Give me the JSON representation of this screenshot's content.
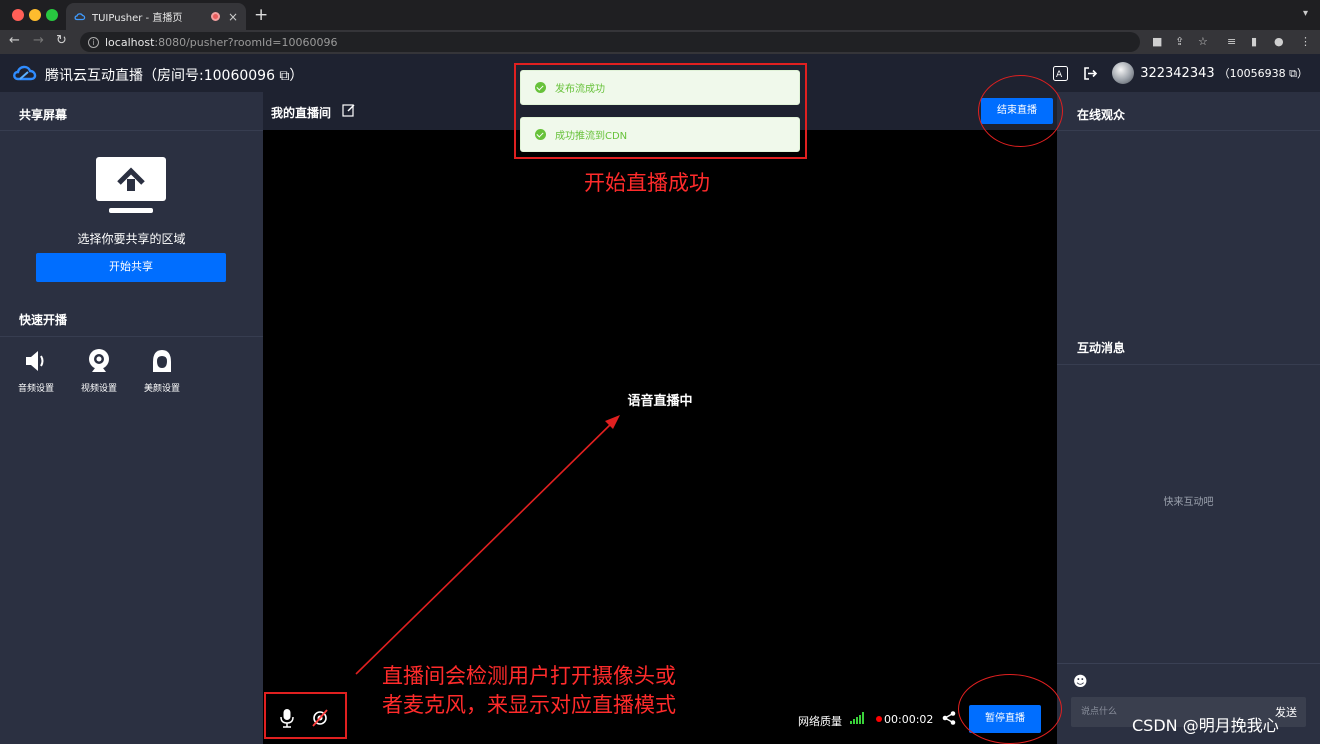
{
  "browser": {
    "tab_title": "TUIPusher - 直播页",
    "tab_close": "×",
    "new_tab": "+",
    "url_host": "localhost",
    "url_path": ":8080/pusher?roomId=10060096"
  },
  "header": {
    "app_title": "腾讯云互动直播（房间号:10060096",
    "user_name": "322342343",
    "user_room": "（10056938"
  },
  "left": {
    "share_title": "共享屏幕",
    "share_hint": "选择你要共享的区域",
    "share_button": "开始共享",
    "quick_title": "快速开播",
    "quick_items": [
      {
        "label": "音频设置",
        "icon": "speaker-icon"
      },
      {
        "label": "视频设置",
        "icon": "webcam-icon"
      },
      {
        "label": "美颜设置",
        "icon": "beauty-face-icon"
      }
    ]
  },
  "center": {
    "room_name": "我的直播间",
    "end_button": "结束直播",
    "audio_status": "语音直播中",
    "network_label": "网络质量",
    "timer": "00:00:02",
    "pause_button": "暂停直播"
  },
  "right": {
    "audience_title": "在线观众",
    "messages_title": "互动消息",
    "empty_messages": "快来互动吧",
    "chat_placeholder": "说点什么",
    "send_label": "发送"
  },
  "toasts": [
    "发布流成功",
    "成功推流到CDN"
  ],
  "annotations": {
    "start_success": "开始直播成功",
    "detect_line1": "直播间会检测用户打开摄像头或",
    "detect_line2": "者麦克风，来显示对应直播模式"
  },
  "watermark": "CSDN @明月挽我心",
  "colors": {
    "accent": "#006eff",
    "panel": "#2b3041",
    "header": "#1e2230",
    "annotation": "#e02020",
    "success": "#67c23a"
  }
}
